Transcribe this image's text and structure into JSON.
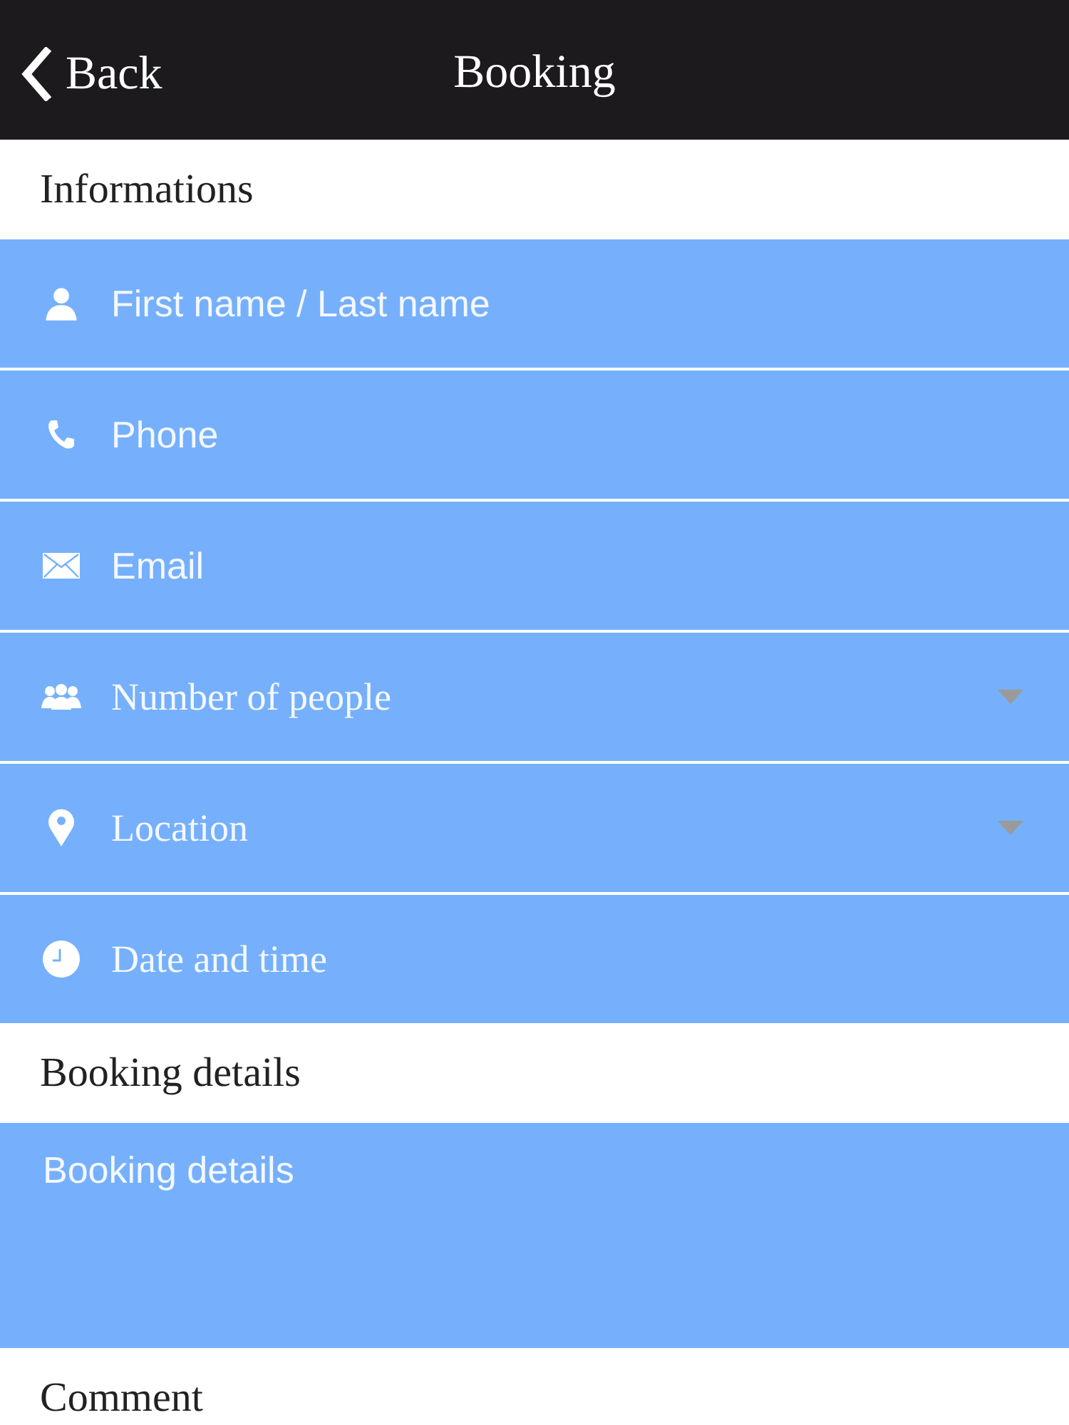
{
  "nav_bar": {
    "back": "Back",
    "title": "Booking"
  },
  "sections": [
    {
      "title": "Informations",
      "fields": [
        {
          "kind": "text",
          "placeholder": "First name / Last name"
        },
        {
          "kind": "text",
          "placeholder": "Phone"
        },
        {
          "kind": "text",
          "placeholder": "Email"
        },
        {
          "kind": "select",
          "placeholder": "Number of people"
        },
        {
          "kind": "select",
          "placeholder": "Location"
        },
        {
          "kind": "datetime",
          "placeholder": "Date and time"
        }
      ]
    },
    {
      "title": "Booking details",
      "fields": [
        {
          "kind": "textarea",
          "placeholder": "Booking details"
        }
      ]
    },
    {
      "title": "Comment"
    }
  ]
}
